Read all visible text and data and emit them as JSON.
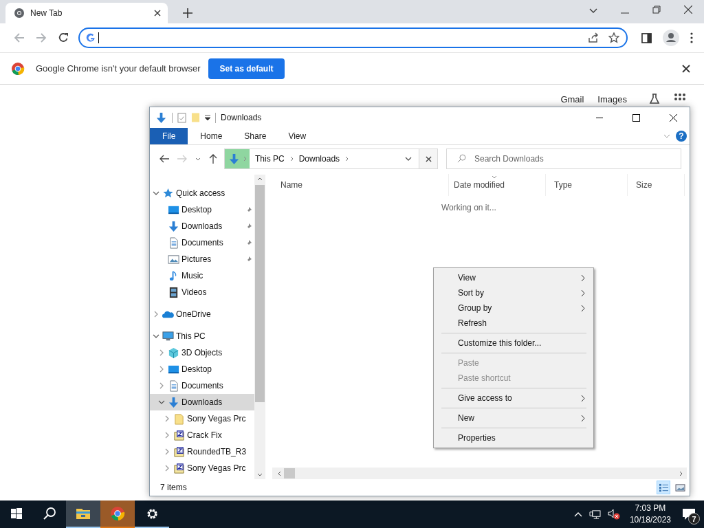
{
  "browser": {
    "tab": {
      "title": "New Tab"
    },
    "infobar": {
      "message": "Google Chrome isn't your default browser",
      "button": "Set as default"
    },
    "page_links": [
      "Gmail",
      "Images"
    ]
  },
  "explorer": {
    "title": "Downloads",
    "ribbon_tabs": [
      {
        "label": "File",
        "kind": "file"
      },
      {
        "label": "Home",
        "kind": "tab"
      },
      {
        "label": "Share",
        "kind": "tab"
      },
      {
        "label": "View",
        "kind": "tab"
      }
    ],
    "help_glyph": "?",
    "breadcrumb": [
      "This PC",
      "Downloads"
    ],
    "search": {
      "placeholder": "Search Downloads"
    },
    "nav_tree": [
      {
        "label": "Quick access",
        "kind": "star",
        "expanded": true,
        "selected": false,
        "children": [
          {
            "label": "Desktop",
            "kind": "desktop",
            "pinned": true,
            "selected": false
          },
          {
            "label": "Downloads",
            "kind": "download",
            "pinned": true,
            "selected": false
          },
          {
            "label": "Documents",
            "kind": "documents",
            "pinned": true,
            "selected": false
          },
          {
            "label": "Pictures",
            "kind": "pictures",
            "pinned": true,
            "selected": false
          },
          {
            "label": "Music",
            "kind": "music",
            "pinned": false,
            "selected": false
          },
          {
            "label": "Videos",
            "kind": "videos",
            "pinned": false,
            "selected": false
          }
        ]
      },
      {
        "label": "OneDrive",
        "kind": "cloud",
        "expanded": false,
        "selected": false
      },
      {
        "label": "This PC",
        "kind": "pc",
        "expanded": true,
        "selected": false,
        "children": [
          {
            "label": "3D Objects",
            "kind": "cube",
            "expanded": false,
            "selected": false
          },
          {
            "label": "Desktop",
            "kind": "desktop",
            "expanded": false,
            "selected": false
          },
          {
            "label": "Documents",
            "kind": "documents",
            "expanded": false,
            "selected": false
          },
          {
            "label": "Downloads",
            "kind": "download",
            "expanded": true,
            "selected": true,
            "children": [
              {
                "label": "Sony Vegas Prc",
                "kind": "folder",
                "expanded": false,
                "selected": false
              },
              {
                "label": "Crack Fix",
                "kind": "zipfolder",
                "expanded": false,
                "selected": false
              },
              {
                "label": "RoundedTB_R3",
                "kind": "zipfolder",
                "expanded": false,
                "selected": false
              },
              {
                "label": "Sony Vegas Prc",
                "kind": "zipfolder",
                "expanded": false,
                "selected": false
              }
            ]
          }
        ]
      }
    ],
    "columns": [
      {
        "label": "Name",
        "sorted": false
      },
      {
        "label": "Date modified",
        "sorted": true
      },
      {
        "label": "Type",
        "sorted": false
      },
      {
        "label": "Size",
        "sorted": false
      }
    ],
    "message": "Working on it...",
    "status_bar": "7 items",
    "view_buttons": [
      {
        "kind": "details",
        "selected": true
      },
      {
        "kind": "large_icons",
        "selected": false
      }
    ]
  },
  "context_menu": [
    {
      "kind": "item",
      "label": "View",
      "submenu": true,
      "disabled": false
    },
    {
      "kind": "item",
      "label": "Sort by",
      "submenu": true,
      "disabled": false
    },
    {
      "kind": "item",
      "label": "Group by",
      "submenu": true,
      "disabled": false
    },
    {
      "kind": "item",
      "label": "Refresh",
      "submenu": false,
      "disabled": false
    },
    {
      "kind": "separator"
    },
    {
      "kind": "item",
      "label": "Customize this folder...",
      "submenu": false,
      "disabled": false
    },
    {
      "kind": "separator"
    },
    {
      "kind": "item",
      "label": "Paste",
      "submenu": false,
      "disabled": true
    },
    {
      "kind": "item",
      "label": "Paste shortcut",
      "submenu": false,
      "disabled": true
    },
    {
      "kind": "separator"
    },
    {
      "kind": "item",
      "label": "Give access to",
      "submenu": true,
      "disabled": false
    },
    {
      "kind": "separator"
    },
    {
      "kind": "item",
      "label": "New",
      "submenu": true,
      "disabled": false
    },
    {
      "kind": "separator"
    },
    {
      "kind": "item",
      "label": "Properties",
      "submenu": false,
      "disabled": false
    }
  ],
  "taskbar": {
    "apps": [
      {
        "kind": "start",
        "running": false,
        "active": false,
        "flashing": false
      },
      {
        "kind": "search",
        "running": false,
        "active": false,
        "flashing": false
      },
      {
        "kind": "explorer",
        "running": true,
        "active": true,
        "flashing": false
      },
      {
        "kind": "chrome",
        "running": true,
        "active": false,
        "flashing": true
      },
      {
        "kind": "settings",
        "running": true,
        "active": false,
        "flashing": false
      }
    ],
    "clock": {
      "time": "7:03 PM",
      "date": "10/18/2023"
    },
    "notifications": "7"
  }
}
